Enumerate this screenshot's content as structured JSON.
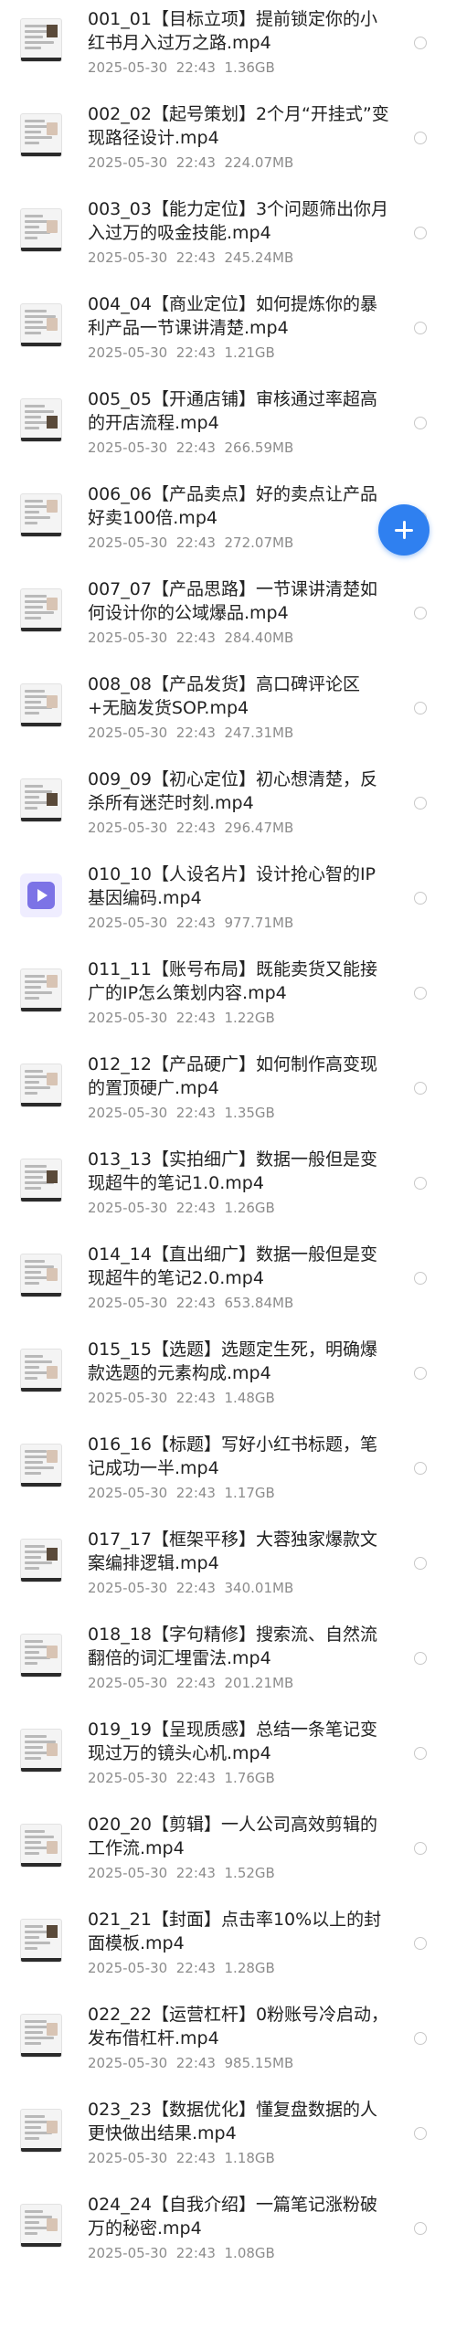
{
  "files": [
    {
      "name": "001_01【目标立项】提前锁定你的小红书月入过万之路.mp4",
      "date": "2025-05-30",
      "time": "22:43",
      "size": "1.36GB"
    },
    {
      "name": "002_02【起号策划】2个月“开挂式”变现路径设计.mp4",
      "date": "2025-05-30",
      "time": "22:43",
      "size": "224.07MB"
    },
    {
      "name": "003_03【能力定位】3个问题筛出你月入过万的吸金技能.mp4",
      "date": "2025-05-30",
      "time": "22:43",
      "size": "245.24MB"
    },
    {
      "name": "004_04【商业定位】如何提炼你的暴利产品一节课讲清楚.mp4",
      "date": "2025-05-30",
      "time": "22:43",
      "size": "1.21GB"
    },
    {
      "name": "005_05【开通店铺】审核通过率超高的开店流程.mp4",
      "date": "2025-05-30",
      "time": "22:43",
      "size": "266.59MB"
    },
    {
      "name": "006_06【产品卖点】好的卖点让产品好卖100倍.mp4",
      "date": "2025-05-30",
      "time": "22:43",
      "size": "272.07MB"
    },
    {
      "name": "007_07【产品思路】一节课讲清楚如何设计你的公域爆品.mp4",
      "date": "2025-05-30",
      "time": "22:43",
      "size": "284.40MB"
    },
    {
      "name": "008_08【产品发货】高口碑评论区+无脑发货SOP.mp4",
      "date": "2025-05-30",
      "time": "22:43",
      "size": "247.31MB"
    },
    {
      "name": "009_09【初心定位】初心想清楚，反杀所有迷茫时刻.mp4",
      "date": "2025-05-30",
      "time": "22:43",
      "size": "296.47MB"
    },
    {
      "name": "010_10【人设名片】设计抢心智的IP基因编码.mp4",
      "date": "2025-05-30",
      "time": "22:43",
      "size": "977.71MB"
    },
    {
      "name": "011_11【账号布局】既能卖货又能接广的IP怎么策划内容.mp4",
      "date": "2025-05-30",
      "time": "22:43",
      "size": "1.22GB"
    },
    {
      "name": "012_12【产品硬广】如何制作高变现的置顶硬广.mp4",
      "date": "2025-05-30",
      "time": "22:43",
      "size": "1.35GB"
    },
    {
      "name": "013_13【实拍细广】数据一般但是变现超牛的笔记1.0.mp4",
      "date": "2025-05-30",
      "time": "22:43",
      "size": "1.26GB"
    },
    {
      "name": "014_14【直出细广】数据一般但是变现超牛的笔记2.0.mp4",
      "date": "2025-05-30",
      "time": "22:43",
      "size": "653.84MB"
    },
    {
      "name": "015_15【选题】选题定生死，明确爆款选题的元素构成.mp4",
      "date": "2025-05-30",
      "time": "22:43",
      "size": "1.48GB"
    },
    {
      "name": "016_16【标题】写好小红书标题，笔记成功一半.mp4",
      "date": "2025-05-30",
      "time": "22:43",
      "size": "1.17GB"
    },
    {
      "name": "017_17【框架平移】大蓉独家爆款文案编排逻辑.mp4",
      "date": "2025-05-30",
      "time": "22:43",
      "size": "340.01MB"
    },
    {
      "name": "018_18【字句精修】搜索流、自然流翻倍的词汇埋雷法.mp4",
      "date": "2025-05-30",
      "time": "22:43",
      "size": "201.21MB"
    },
    {
      "name": "019_19【呈现质感】总结一条笔记变现过万的镜头心机.mp4",
      "date": "2025-05-30",
      "time": "22:43",
      "size": "1.76GB"
    },
    {
      "name": "020_20【剪辑】一人公司高效剪辑的工作流.mp4",
      "date": "2025-05-30",
      "time": "22:43",
      "size": "1.52GB"
    },
    {
      "name": "021_21【封面】点击率10%以上的封面模板.mp4",
      "date": "2025-05-30",
      "time": "22:43",
      "size": "1.28GB"
    },
    {
      "name": "022_22【运营杠杆】0粉账号冷启动，发布借杠杆.mp4",
      "date": "2025-05-30",
      "time": "22:43",
      "size": "985.15MB"
    },
    {
      "name": "023_23【数据优化】懂复盘数据的人更快做出结果.mp4",
      "date": "2025-05-30",
      "time": "22:43",
      "size": "1.18GB"
    },
    {
      "name": "024_24【自我介绍】一篇笔记涨粉破万的秘密.mp4",
      "date": "2025-05-30",
      "time": "22:43",
      "size": "1.08GB"
    }
  ],
  "fab": {
    "icon": "plus-icon",
    "color": "#2f80f0"
  }
}
